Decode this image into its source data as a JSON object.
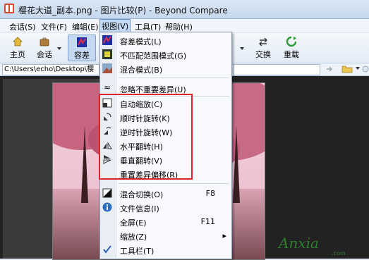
{
  "window": {
    "title": "樱花大道_副本.png - 图片比较(P) - Beyond Compare"
  },
  "menubar": [
    {
      "label": "会话(S)"
    },
    {
      "label": "文件(F)"
    },
    {
      "label": "编辑(E)"
    },
    {
      "label": "视图(V)"
    },
    {
      "label": "工具(T)"
    },
    {
      "label": "帮助(H)"
    }
  ],
  "toolbar": {
    "home": "主页",
    "session": "会话",
    "diff": "容差",
    "swap": "交换",
    "reload": "重载"
  },
  "path": {
    "left": "C:\\Users\\echo\\Desktop\\樱"
  },
  "view_menu": {
    "items": [
      {
        "label": "容差模式(L)",
        "shortcut": "",
        "icon": "diff-mode-icon"
      },
      {
        "label": "不匹配范围模式(G)",
        "shortcut": "",
        "icon": "mismatch-mode-icon"
      },
      {
        "label": "混合模式(B)",
        "shortcut": "",
        "icon": "blend-mode-icon"
      },
      {
        "label": "忽略不重要差异(U)",
        "shortcut": "",
        "icon": "approx-icon"
      },
      {
        "label": "自动缩放(C)",
        "shortcut": "",
        "icon": "auto-zoom-icon"
      },
      {
        "label": "顺时针旋转(K)",
        "shortcut": "",
        "icon": "rotate-cw-icon"
      },
      {
        "label": "逆时针旋转(W)",
        "shortcut": "",
        "icon": "rotate-ccw-icon"
      },
      {
        "label": "水平翻转(H)",
        "shortcut": "",
        "icon": "flip-horizontal-icon"
      },
      {
        "label": "垂直翻转(V)",
        "shortcut": "",
        "icon": "flip-vertical-icon"
      },
      {
        "label": "重置差异偏移(R)",
        "shortcut": "",
        "icon": ""
      },
      {
        "label": "混合切换(O)",
        "shortcut": "F8",
        "icon": "blend-toggle-icon"
      },
      {
        "label": "文件信息(I)",
        "shortcut": "",
        "icon": "info-icon"
      },
      {
        "label": "全屏(E)",
        "shortcut": "F11",
        "icon": ""
      },
      {
        "label": "缩放(Z)",
        "shortcut": "▸",
        "icon": ""
      },
      {
        "label": "工具栏(T)",
        "shortcut": "",
        "icon": "checkmark-icon"
      }
    ]
  },
  "watermark": {
    "text": "Anxia",
    "sub": ".com"
  },
  "colors": {
    "accent": "#e0242b",
    "menu_bg": "#f7f9fc",
    "title_bg": "#c6d8ee"
  }
}
